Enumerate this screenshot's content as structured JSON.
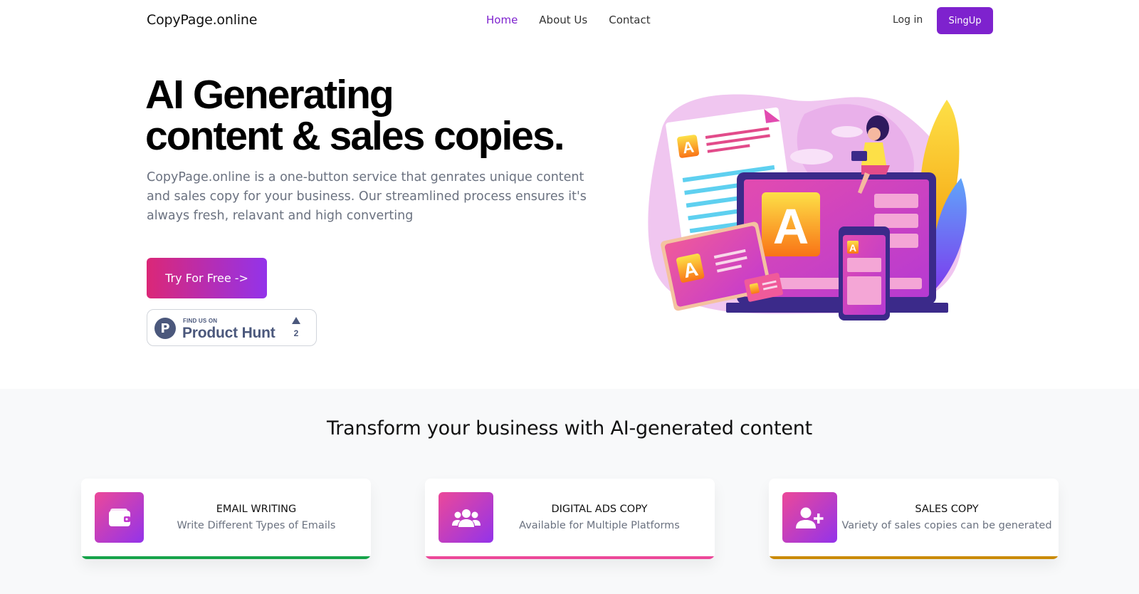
{
  "nav": {
    "brand": "CopyPage.online",
    "links": [
      {
        "label": "Home",
        "active": true
      },
      {
        "label": "About Us",
        "active": false
      },
      {
        "label": "Contact",
        "active": false
      }
    ],
    "login_label": "Log in",
    "signup_label": "SingUp"
  },
  "hero": {
    "title_line1": "AI Generating",
    "title_line2": "content & sales copies.",
    "description": "CopyPage.online is a one-button service that genrates unique content and sales copy for your business. Our streamlined process ensures it's always fresh, relavant and high converting",
    "cta_label": "Try For Free ->",
    "product_hunt": {
      "small_label": "FIND US ON",
      "big_label": "Product Hunt",
      "logo_letter": "P",
      "upvotes": "2"
    }
  },
  "features": {
    "title": "Transform your business with AI-generated content",
    "cards": [
      {
        "title": "EMAIL WRITING",
        "description": "Write Different Types of Emails",
        "icon": "wallet-icon",
        "accent": "#16a34a"
      },
      {
        "title": "DIGITAL ADS COPY",
        "description": "Available for Multiple Platforms",
        "icon": "users-icon",
        "accent": "#ec4899"
      },
      {
        "title": "SALES COPY",
        "description": "Variety of sales copies can be generated",
        "icon": "user-plus-icon",
        "accent": "#ca8a04"
      }
    ]
  },
  "colors": {
    "accent": "#7e22ce",
    "gradient_start": "#db2777",
    "gradient_end": "#9333ea"
  }
}
